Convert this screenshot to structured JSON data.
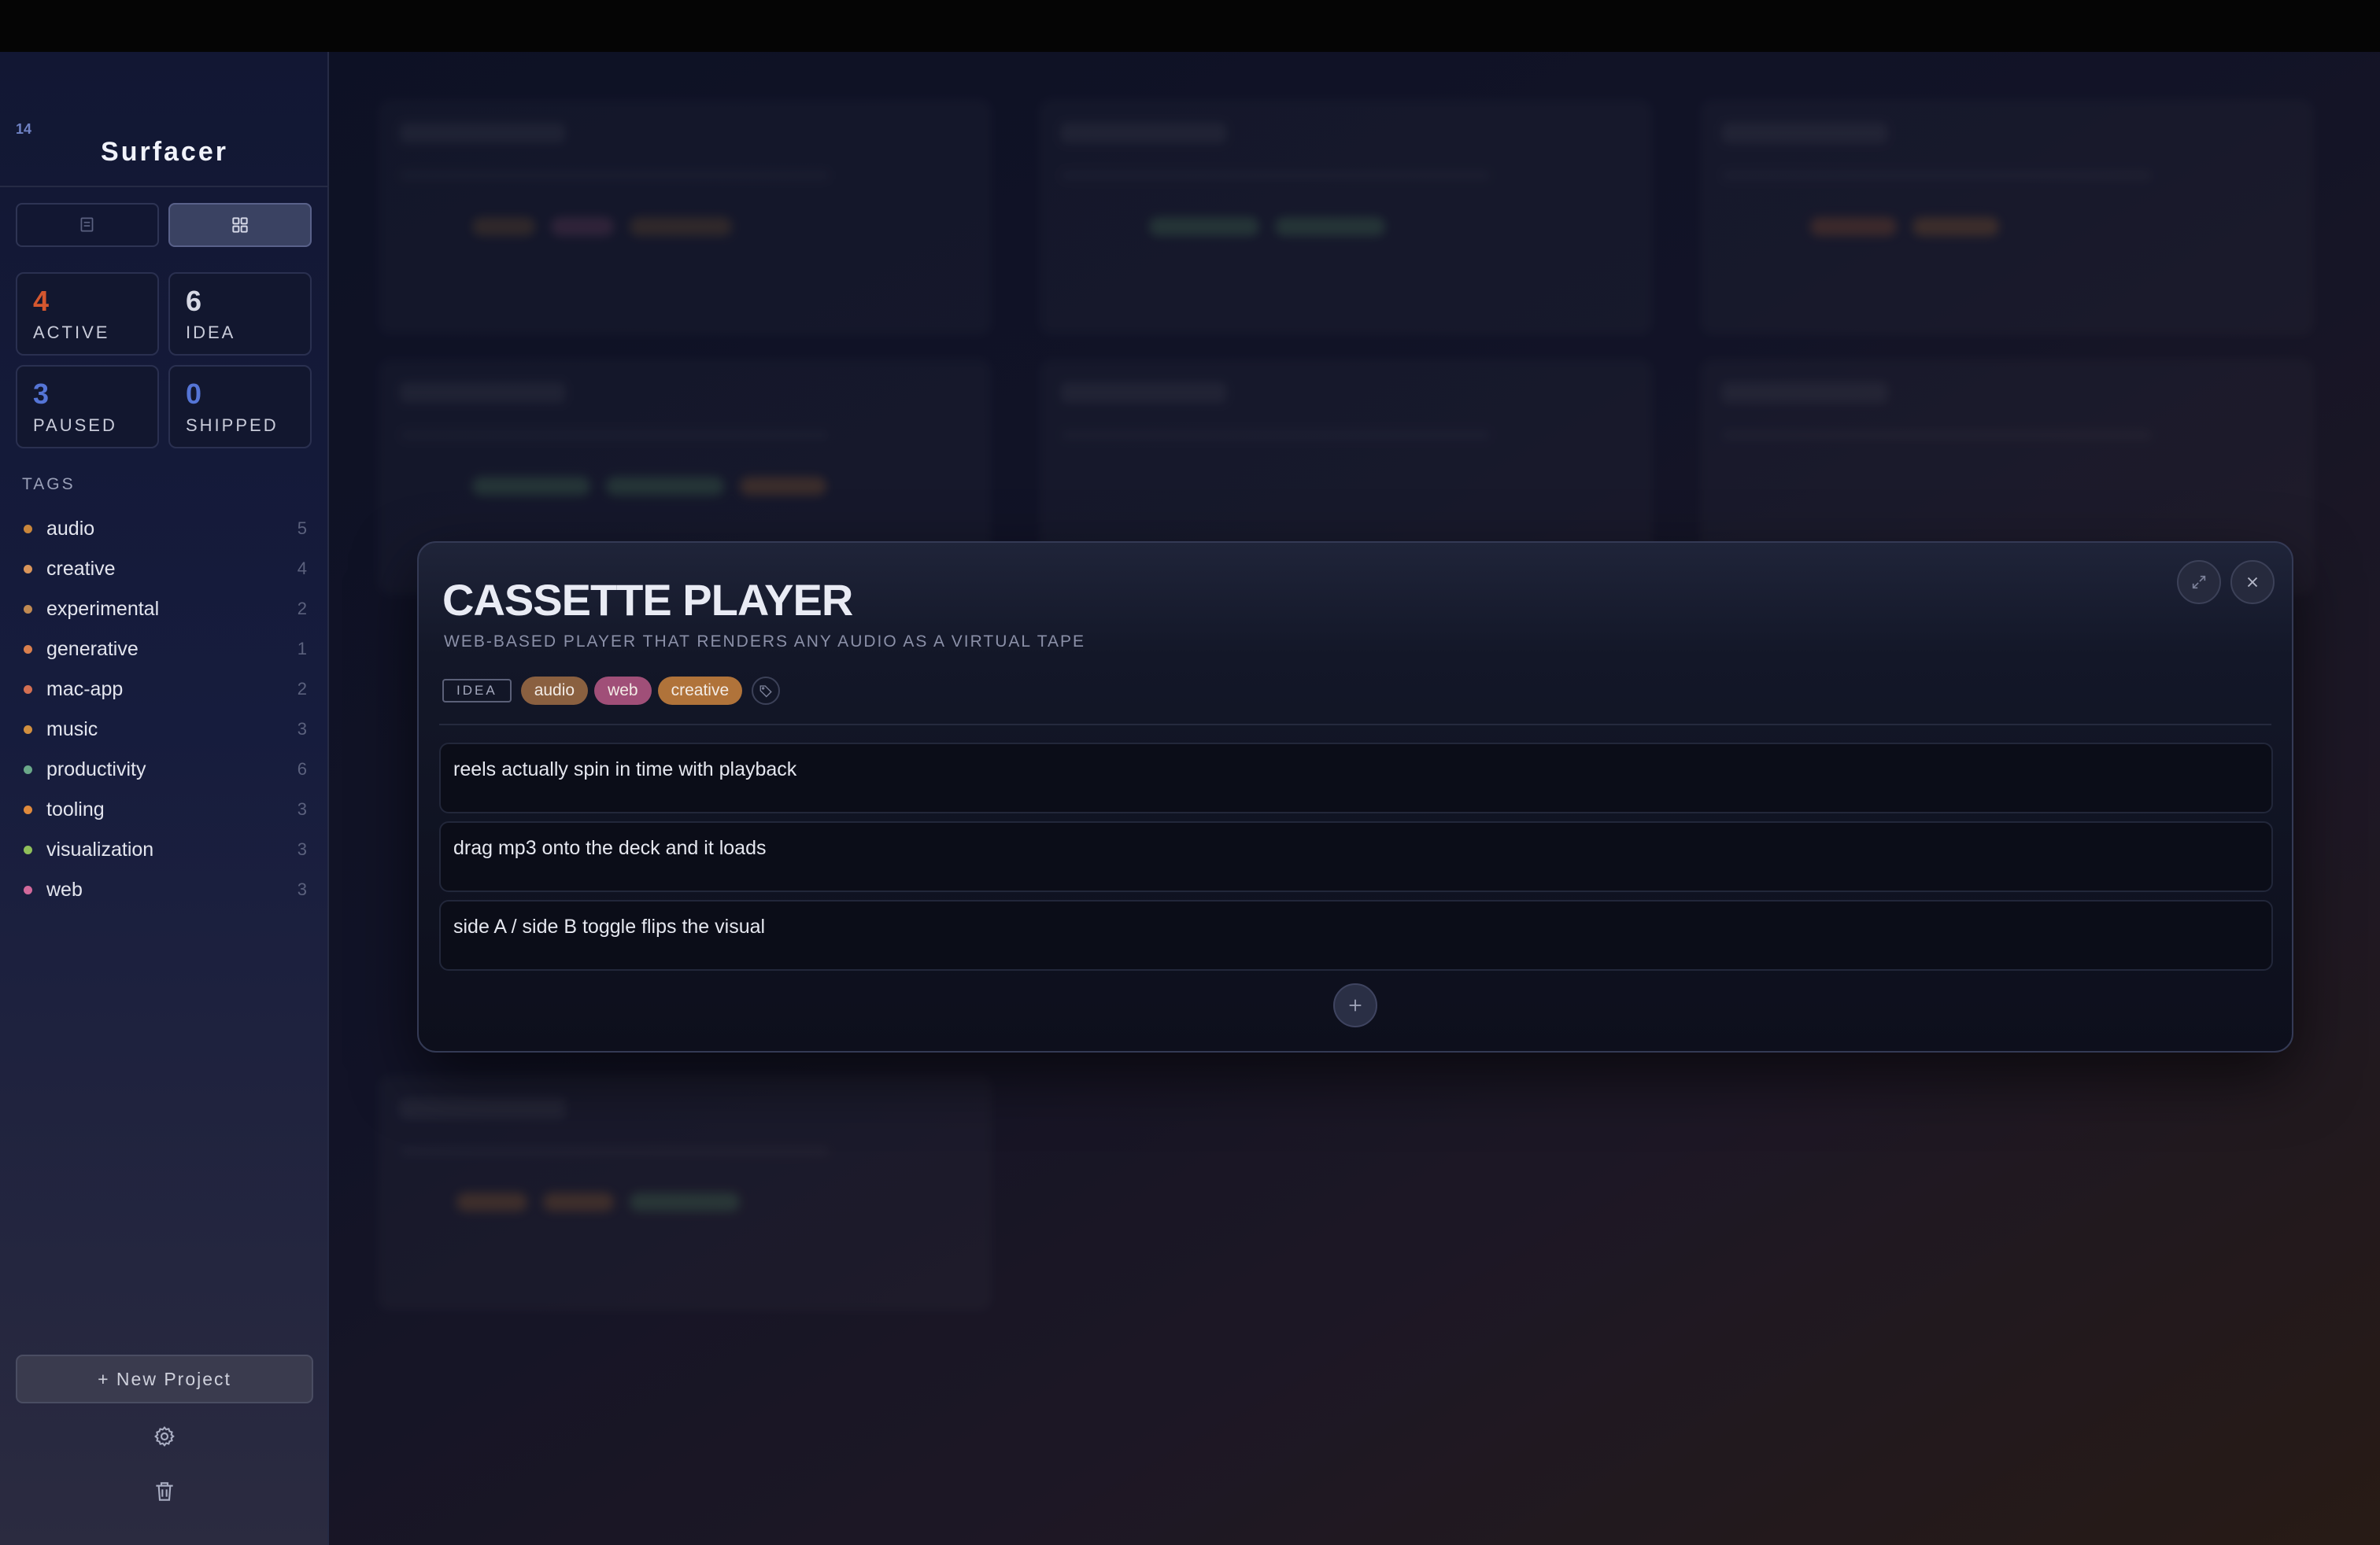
{
  "app": {
    "title": "Surfacer",
    "project_count": "14"
  },
  "stats": [
    {
      "value": "4",
      "label": "ACTIVE",
      "color": "#d4572f"
    },
    {
      "value": "6",
      "label": "IDEA",
      "color": "#d7d9e5"
    },
    {
      "value": "3",
      "label": "PAUSED",
      "color": "#5575d6"
    },
    {
      "value": "0",
      "label": "SHIPPED",
      "color": "#5575d6"
    }
  ],
  "tags": {
    "header": "TAGS",
    "items": [
      {
        "name": "audio",
        "count": "5",
        "color": "#c9863b"
      },
      {
        "name": "creative",
        "count": "4",
        "color": "#d9955a"
      },
      {
        "name": "experimental",
        "count": "2",
        "color": "#c08a52"
      },
      {
        "name": "generative",
        "count": "1",
        "color": "#d97f4d"
      },
      {
        "name": "mac-app",
        "count": "2",
        "color": "#d36f52"
      },
      {
        "name": "music",
        "count": "3",
        "color": "#d18f3f"
      },
      {
        "name": "productivity",
        "count": "6",
        "color": "#6aa889"
      },
      {
        "name": "tooling",
        "count": "3",
        "color": "#df8a3c"
      },
      {
        "name": "visualization",
        "count": "3",
        "color": "#8fbf5a"
      },
      {
        "name": "web",
        "count": "3",
        "color": "#d2699b"
      }
    ]
  },
  "sidebar_footer": {
    "new_project_label": "+ New Project",
    "settings_icon": "gear-icon",
    "trash_icon": "trash-icon"
  },
  "modal": {
    "title": "CASSETTE PLAYER",
    "subtitle": "WEB-BASED PLAYER THAT RENDERS ANY AUDIO AS A VIRTUAL TAPE",
    "status": "IDEA",
    "tags": [
      {
        "name": "audio",
        "color": "#8a6040"
      },
      {
        "name": "web",
        "color": "#a04f78"
      },
      {
        "name": "creative",
        "color": "#b0733a"
      }
    ],
    "notes": [
      "reels actually spin in time with playback",
      "drag mp3 onto the deck and it loads",
      "side A / side B toggle flips the visual"
    ]
  }
}
